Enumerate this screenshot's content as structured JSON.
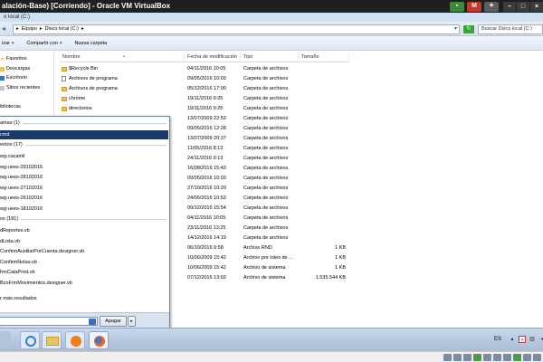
{
  "vbox": {
    "title": "alación-Base) [Corriendo] - Oracle VM VirtualBox",
    "tray_m": "M",
    "minimize": "–",
    "maximize": "□",
    "close": "×"
  },
  "explorer": {
    "window_title": "o local (C:)",
    "breadcrumb": [
      "Equipo",
      "Disco local (C:)"
    ],
    "breadcrumb_sep": "▸",
    "search_placeholder": "Buscar Disco local (C:)",
    "toolbar": {
      "organize": "izar",
      "share": "Compartir con",
      "new_folder": "Nueva carpeta"
    }
  },
  "nav_pane": {
    "items": [
      {
        "label": "Favoritos"
      },
      {
        "label": "Descargas"
      },
      {
        "label": "Escritorio"
      },
      {
        "label": "Sitios recientes"
      },
      {
        "label": "ibliotecas"
      }
    ]
  },
  "file_list": {
    "columns": {
      "name": "Nombre",
      "date": "Fecha de modificación",
      "type": "Tipo",
      "size": "Tamaño"
    },
    "rows": [
      {
        "name": "$Recycle.Bin",
        "date": "04/11/2016 10:05",
        "type": "Carpeta de archivos",
        "size": "",
        "kind": "folder"
      },
      {
        "name": "Archivos de programa",
        "date": "09/05/2016 10:03",
        "type": "Carpeta de archivos",
        "size": "",
        "kind": "shortcut"
      },
      {
        "name": "Archivos de programa",
        "date": "05/12/2016 17:00",
        "type": "Carpeta de archivos",
        "size": "",
        "kind": "folder"
      },
      {
        "name": "chrome",
        "date": "19/11/2016 9:25",
        "type": "Carpeta de archivos",
        "size": "",
        "kind": "folder"
      },
      {
        "name": "directorioe",
        "date": "19/11/2016 9:25",
        "type": "Carpeta de archivos",
        "size": "",
        "kind": "folder"
      },
      {
        "name": "",
        "date": "13/07/2009 22:53",
        "type": "Carpeta de archivos",
        "size": "",
        "kind": "none"
      },
      {
        "name": "",
        "date": "09/05/2016 12:28",
        "type": "Carpeta de archivos",
        "size": "",
        "kind": "none"
      },
      {
        "name": "",
        "date": "13/07/2009 20:37",
        "type": "Carpeta de archivos",
        "size": "",
        "kind": "none"
      },
      {
        "name": "",
        "date": "11/05/2016 8:13",
        "type": "Carpeta de archivos",
        "size": "",
        "kind": "none"
      },
      {
        "name": "",
        "date": "24/11/2016 9:13",
        "type": "Carpeta de archivos",
        "size": "",
        "kind": "none"
      },
      {
        "name": "",
        "date": "16/08/2016 15:43",
        "type": "Carpeta de archivos",
        "size": "",
        "kind": "none"
      },
      {
        "name": "",
        "date": "09/05/2016 10:03",
        "type": "Carpeta de archivos",
        "size": "",
        "kind": "none"
      },
      {
        "name": "",
        "date": "27/10/2016 10:20",
        "type": "Carpeta de archivos",
        "size": "",
        "kind": "none"
      },
      {
        "name": "",
        "date": "24/06/2016 10:53",
        "type": "Carpeta de archivos",
        "size": "",
        "kind": "none"
      },
      {
        "name": "",
        "date": "09/12/2016 15:54",
        "type": "Carpeta de archivos",
        "size": "",
        "kind": "none"
      },
      {
        "name": "",
        "date": "04/11/2016 10:05",
        "type": "Carpeta de archivos",
        "size": "",
        "kind": "none"
      },
      {
        "name": "",
        "date": "23/11/2016 13:25",
        "type": "Carpeta de archivos",
        "size": "",
        "kind": "none"
      },
      {
        "name": "",
        "date": "14/12/2016 14:19",
        "type": "Carpeta de archivos",
        "size": "",
        "kind": "none"
      },
      {
        "name": "",
        "date": "06/10/2016 9:58",
        "type": "Archivo RND",
        "size": "1 KB",
        "kind": "none"
      },
      {
        "name": "",
        "date": "10/06/2009 15:42",
        "type": "Archivo por lotes de ...",
        "size": "1 KB",
        "kind": "none"
      },
      {
        "name": "",
        "date": "10/06/2009 15:42",
        "type": "Archivo de sistema",
        "size": "1 KB",
        "kind": "none"
      },
      {
        "name": "",
        "date": "07/12/2016 13:03",
        "type": "Archivo de sistema",
        "size": "1.535.544 KB",
        "kind": "none"
      }
    ]
  },
  "start_menu": {
    "programs_header": "amas (1)",
    "programs": [
      "cmd"
    ],
    "documents_header": "entos (17)",
    "documents": [
      "wg-cacamil",
      "wg-uees-29102016",
      "wg-uees-28102016",
      "wg-uees-27102016",
      "wg-uees-26102016",
      "wg-uees-18102016"
    ],
    "files_header": "os (181)",
    "files": [
      "dReportes.vb",
      "dLista.vb",
      "ConfirmAuxiliarPorCuenta.designer.vb",
      "ConfirmNotas.vb",
      "frmCataProd.vb",
      "BcoFrmMovimientos.designer.vb"
    ],
    "more_results": "r más resultados",
    "shutdown_label": "Apagar",
    "shutdown_arrow": "▸"
  },
  "taskbar": {
    "language": "ES",
    "tray_up": "▴",
    "tray_flag": "✕",
    "tray_net": "▥",
    "tray_vol": "◂"
  },
  "colors": {
    "selected_row": "#1a3a6b",
    "folder": "#e8c562",
    "vbox_title_bg": "#1f1f1f"
  }
}
